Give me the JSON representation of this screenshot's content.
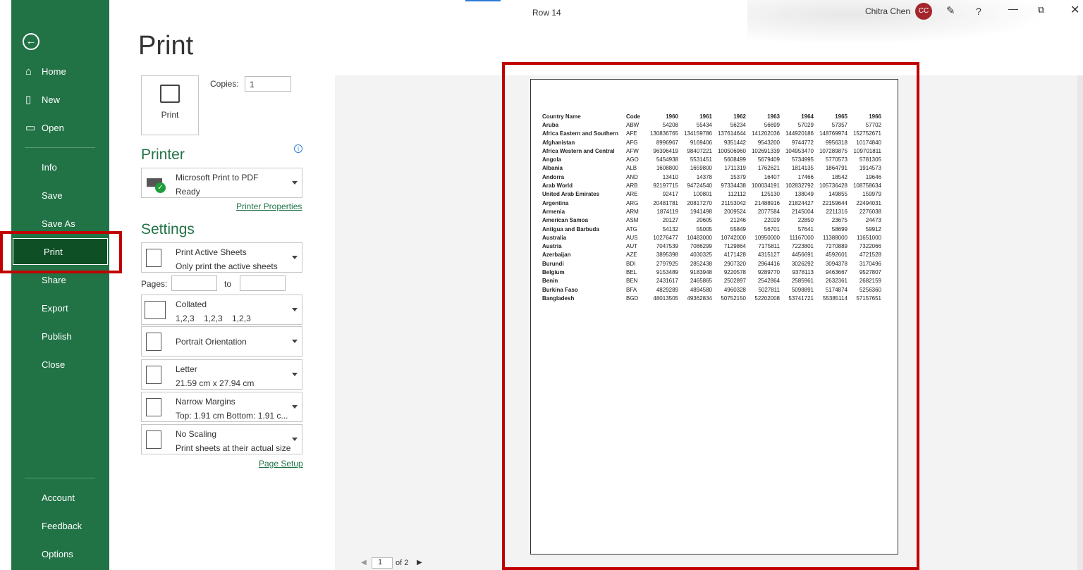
{
  "window": {
    "doc_title": "Row 14",
    "user": "Chitra Chen",
    "user_initials": "CC",
    "help": "?"
  },
  "sidebar": {
    "items": [
      {
        "label": "Home",
        "icon": "home-icon"
      },
      {
        "label": "New",
        "icon": "new-file-icon"
      },
      {
        "label": "Open",
        "icon": "folder-open-icon"
      },
      {
        "label": "Info"
      },
      {
        "label": "Save"
      },
      {
        "label": "Save As"
      },
      {
        "label": "Print",
        "active": true
      },
      {
        "label": "Share"
      },
      {
        "label": "Export"
      },
      {
        "label": "Publish"
      },
      {
        "label": "Close"
      }
    ],
    "bottom": [
      {
        "label": "Account"
      },
      {
        "label": "Feedback"
      },
      {
        "label": "Options"
      }
    ]
  },
  "print": {
    "title": "Print",
    "button": "Print",
    "copies_label": "Copies:",
    "copies": "1",
    "printer_header": "Printer",
    "printer_name": "Microsoft Print to PDF",
    "printer_status": "Ready",
    "printer_properties": "Printer Properties",
    "settings_header": "Settings",
    "settings": [
      {
        "l1": "Print Active Sheets",
        "l2": "Only print the active sheets"
      },
      {
        "l1": "Collated",
        "l2": "1,2,3    1,2,3    1,2,3"
      },
      {
        "l1": "Portrait Orientation",
        "l2": ""
      },
      {
        "l1": "Letter",
        "l2": "21.59 cm x 27.94 cm"
      },
      {
        "l1": "Narrow Margins",
        "l2": "Top: 1.91 cm Bottom: 1.91 c..."
      },
      {
        "l1": "No Scaling",
        "l2": "Print sheets at their actual size"
      }
    ],
    "pages_label": "Pages:",
    "to_label": "to",
    "page_setup": "Page Setup"
  },
  "preview": {
    "page": "1",
    "of": "of 2",
    "headers": [
      "Country Name",
      "Code",
      "1960",
      "1961",
      "1962",
      "1963",
      "1964",
      "1965",
      "1966"
    ],
    "rows": [
      [
        "Aruba",
        "ABW",
        "54208",
        "55434",
        "56234",
        "56699",
        "57029",
        "57357",
        "57702"
      ],
      [
        "Africa Eastern and Southern",
        "AFE",
        "130836765",
        "134159786",
        "137614644",
        "141202036",
        "144920186",
        "148769974",
        "152752671"
      ],
      [
        "Afghanistan",
        "AFG",
        "8996967",
        "9169406",
        "9351442",
        "9543200",
        "9744772",
        "9956318",
        "10174840"
      ],
      [
        "Africa Western and Central",
        "AFW",
        "96396419",
        "98407221",
        "100506960",
        "102691339",
        "104953470",
        "107289875",
        "109701811"
      ],
      [
        "Angola",
        "AGO",
        "5454938",
        "5531451",
        "5608499",
        "5679409",
        "5734995",
        "5770573",
        "5781305"
      ],
      [
        "Albania",
        "ALB",
        "1608800",
        "1659800",
        "1711319",
        "1762621",
        "1814135",
        "1864791",
        "1914573"
      ],
      [
        "Andorra",
        "AND",
        "13410",
        "14378",
        "15379",
        "16407",
        "17466",
        "18542",
        "19646"
      ],
      [
        "Arab World",
        "ARB",
        "92197715",
        "94724540",
        "97334438",
        "100034191",
        "102832792",
        "105736428",
        "108758634"
      ],
      [
        "United Arab Emirates",
        "ARE",
        "92417",
        "100801",
        "112112",
        "125130",
        "138049",
        "149855",
        "159979"
      ],
      [
        "Argentina",
        "ARG",
        "20481781",
        "20817270",
        "21153042",
        "21488916",
        "21824427",
        "22159644",
        "22494031"
      ],
      [
        "Armenia",
        "ARM",
        "1874119",
        "1941498",
        "2009524",
        "2077584",
        "2145004",
        "2211316",
        "2276038"
      ],
      [
        "American Samoa",
        "ASM",
        "20127",
        "20605",
        "21246",
        "22029",
        "22850",
        "23675",
        "24473"
      ],
      [
        "Antigua and Barbuda",
        "ATG",
        "54132",
        "55005",
        "55849",
        "56701",
        "57641",
        "58699",
        "59912"
      ],
      [
        "Australia",
        "AUS",
        "10276477",
        "10483000",
        "10742000",
        "10950000",
        "11167000",
        "11388000",
        "11651000"
      ],
      [
        "Austria",
        "AUT",
        "7047539",
        "7086299",
        "7129864",
        "7175811",
        "7223801",
        "7270889",
        "7322066"
      ],
      [
        "Azerbaijan",
        "AZE",
        "3895398",
        "4030325",
        "4171428",
        "4315127",
        "4456691",
        "4592601",
        "4721528"
      ],
      [
        "Burundi",
        "BDI",
        "2797925",
        "2852438",
        "2907320",
        "2964416",
        "3026292",
        "3094378",
        "3170496"
      ],
      [
        "Belgium",
        "BEL",
        "9153489",
        "9183948",
        "9220578",
        "9289770",
        "9378113",
        "9463667",
        "9527807"
      ],
      [
        "Benin",
        "BEN",
        "2431617",
        "2465865",
        "2502897",
        "2542864",
        "2585961",
        "2632361",
        "2682159"
      ],
      [
        "Burkina Faso",
        "BFA",
        "4829289",
        "4894580",
        "4960328",
        "5027811",
        "5098891",
        "5174874",
        "5256360"
      ],
      [
        "Bangladesh",
        "BGD",
        "48013505",
        "49362834",
        "50752150",
        "52202008",
        "53741721",
        "55385114",
        "57157651"
      ]
    ]
  },
  "colors": {
    "brand": "#217346",
    "active": "#0e4f25",
    "highlight": "#c00000",
    "avatar": "#a4262c"
  }
}
